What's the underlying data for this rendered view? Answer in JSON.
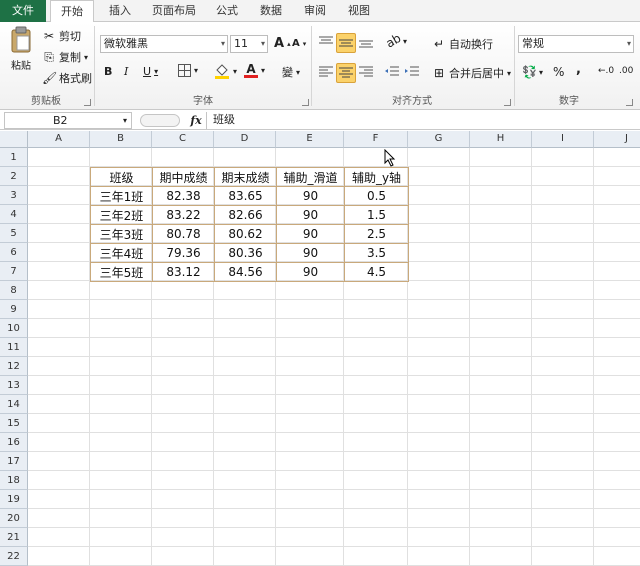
{
  "tabs": [
    "文件",
    "开始",
    "插入",
    "页面布局",
    "公式",
    "数据",
    "审阅",
    "视图"
  ],
  "clipboard": {
    "paste": "粘贴",
    "cut": "剪切",
    "copy": "复制",
    "format_painter": "格式刷",
    "label": "剪贴板"
  },
  "font": {
    "name": "微软雅黑",
    "size": "11",
    "bold": "B",
    "italic": "I",
    "underline": "U",
    "grow": "A",
    "shrink": "A",
    "font_color": "A",
    "phonetic": "變",
    "label": "字体"
  },
  "alignment": {
    "wrap": "自动换行",
    "merge": "合并后居中",
    "label": "对齐方式"
  },
  "number": {
    "format": "常规",
    "percent": "%",
    "comma": ",",
    "label": "数字"
  },
  "formula_bar": {
    "name_box": "B2",
    "fx": "fx",
    "content": "班级"
  },
  "columns": [
    "A",
    "B",
    "C",
    "D",
    "E",
    "F",
    "G",
    "H",
    "I",
    "J"
  ],
  "rows": [
    "1",
    "2",
    "3",
    "4",
    "5",
    "6",
    "7",
    "8",
    "9",
    "10",
    "11",
    "12",
    "13",
    "14",
    "15",
    "16",
    "17",
    "18",
    "19",
    "20",
    "21",
    "22"
  ],
  "table": {
    "headers": [
      "班级",
      "期中成绩",
      "期末成绩",
      "辅助_滑道",
      "辅助_y轴"
    ],
    "rows": [
      [
        "三年1班",
        "82.38",
        "83.65",
        "90",
        "0.5"
      ],
      [
        "三年2班",
        "83.22",
        "82.66",
        "90",
        "1.5"
      ],
      [
        "三年3班",
        "80.78",
        "80.62",
        "90",
        "2.5"
      ],
      [
        "三年4班",
        "79.36",
        "80.36",
        "90",
        "3.5"
      ],
      [
        "三年5班",
        "83.12",
        "84.56",
        "90",
        "4.5"
      ]
    ]
  }
}
